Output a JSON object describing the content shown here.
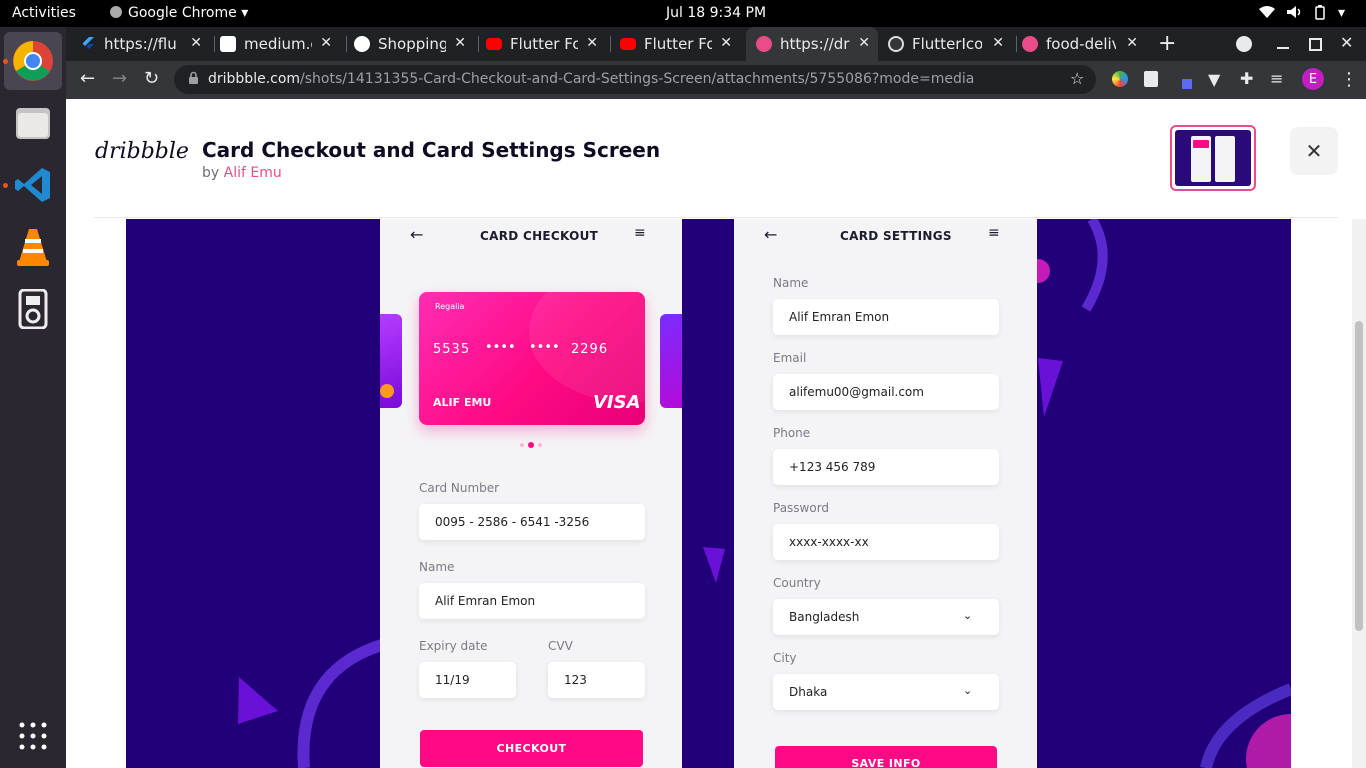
{
  "system": {
    "activities": "Activities",
    "app_name": "Google Chrome",
    "clock": "Jul 18   9:34 PM"
  },
  "tabs": [
    {
      "title": "https://flu",
      "color": "#42a5f5"
    },
    {
      "title": "medium.co",
      "color": "#ffffff"
    },
    {
      "title": "Shopping",
      "color": "#ffffff"
    },
    {
      "title": "Flutter Fo",
      "color": "#ff0000"
    },
    {
      "title": "Flutter Fo",
      "color": "#ff0000"
    },
    {
      "title": "https://dr",
      "color": "#ea4c89"
    },
    {
      "title": "FlutterIco",
      "color": "#dddddd"
    },
    {
      "title": "food-deliv",
      "color": "#ea4c89"
    }
  ],
  "url": {
    "domain": "dribbble.com",
    "path": "/shots/14131355-Card-Checkout-and-Card-Settings-Screen/attachments/5755086?mode=media"
  },
  "profile_initial": "E",
  "shot": {
    "logo": "dribbble",
    "title": "Card Checkout and Card Settings Screen",
    "by": "by",
    "author": "Alif Emu"
  },
  "checkout": {
    "title": "CARD CHECKOUT",
    "card": {
      "bank": "Regalia",
      "number_start": "5535",
      "mask1": "••••",
      "mask2": "••••",
      "number_end": "2296",
      "holder": "ALIF EMU",
      "brand": "VISA"
    },
    "card_number_label": "Card Number",
    "card_number": "0095 - 2586 - 6541 -3256",
    "name_label": "Name",
    "name": "Alif Emran Emon",
    "expiry_label": "Expiry date",
    "expiry": "11/19",
    "cvv_label": "CVV",
    "cvv": "123",
    "button": "CHECKOUT"
  },
  "settings": {
    "title": "CARD SETTINGS",
    "name_label": "Name",
    "name": "Alif Emran Emon",
    "email_label": "Email",
    "email": "alifemu00@gmail.com",
    "phone_label": "Phone",
    "phone": "+123 456 789",
    "password_label": "Password",
    "password": "xxxx-xxxx-xx",
    "country_label": "Country",
    "country": "Bangladesh",
    "city_label": "City",
    "city": "Dhaka",
    "button": "SAVE INFO"
  },
  "colors": {
    "accent": "#ff0a84",
    "bg_purple": "#22007a",
    "topbar": "#000000",
    "dock": "#2b2730"
  }
}
